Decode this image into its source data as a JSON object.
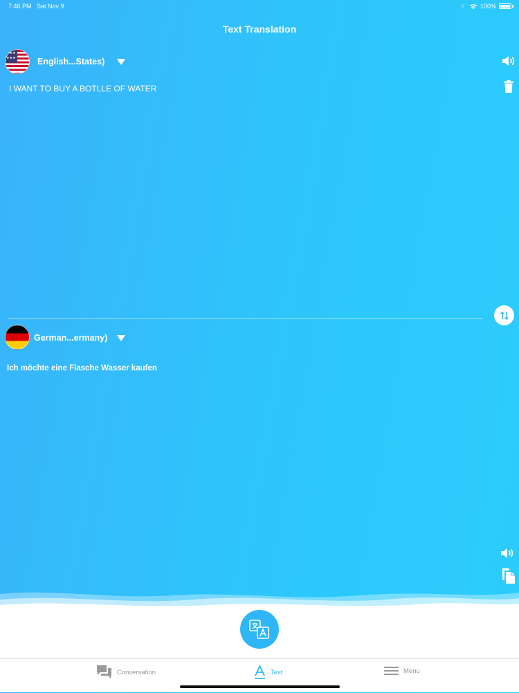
{
  "status": {
    "time": "7:46 PM",
    "date": "Sat Nov 9",
    "battery": "100%"
  },
  "header": {
    "title": "Text Translation"
  },
  "source": {
    "language": "English...States)",
    "flag_icon": "us-flag-icon",
    "text": "I WANT TO BUY A BOTLLE OF WATER"
  },
  "target": {
    "language": "German...ermany)",
    "flag_icon": "germany-flag-icon",
    "text": "Ich möchte eine Flasche Wasser kaufen"
  },
  "tabs": [
    {
      "label": "Conversation",
      "icon": "chat-bubbles-icon",
      "active": false
    },
    {
      "label": "Text",
      "icon": "text-a-icon",
      "active": true
    },
    {
      "label": "Menu",
      "icon": "hamburger-menu-icon",
      "active": false
    }
  ],
  "colors": {
    "background_left": "#3ab2fb",
    "background_right": "#2bcdfc",
    "accent": "#2eb6f6",
    "tab_inactive": "#9a9a9a"
  }
}
